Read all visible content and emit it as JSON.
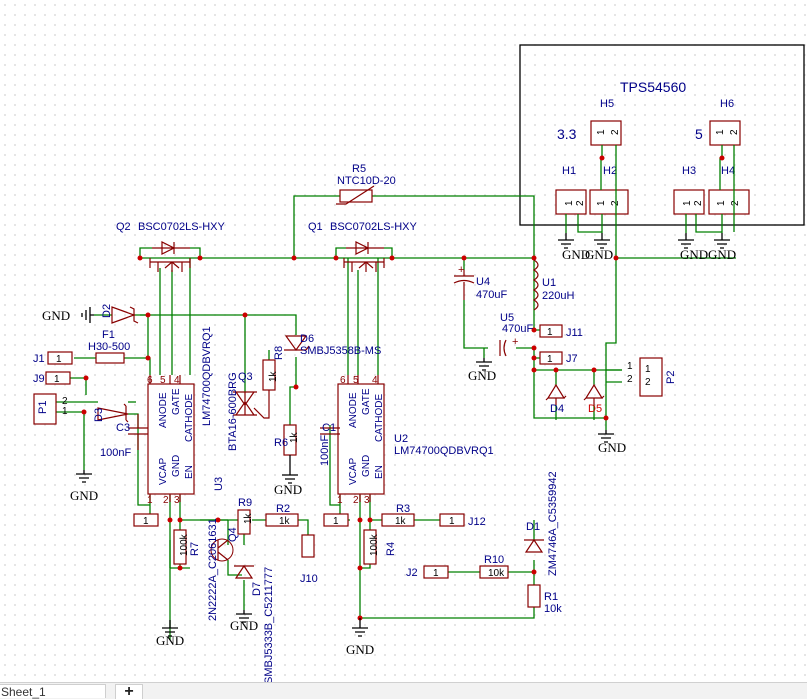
{
  "module": {
    "title": "TPS54560",
    "label_33": "3.3",
    "label_5": "5"
  },
  "headers": {
    "H1": "H1",
    "H2": "H2",
    "H3": "H3",
    "H4": "H4",
    "H5": "H5",
    "H6": "H6"
  },
  "gnd_label": "GND",
  "parts": {
    "Q1_ref": "Q1",
    "Q1_val": "BSC0702LS-HXY",
    "Q2_ref": "Q2",
    "Q2_val": "BSC0702LS-HXY",
    "R5_ref": "R5",
    "R5_val": "NTC10D-20",
    "U4_ref": "U4",
    "U4_val": "470uF",
    "U5_ref": "U5",
    "U5_val": "470uF",
    "U1_ref": "U1",
    "U1_val": "220uH",
    "F1_ref": "F1",
    "F1_val": "H30-500",
    "D2_ref": "D2",
    "D3_ref": "D3",
    "D6_ref": "D6",
    "D6_val": "SMBJ5358B-MS",
    "Q3_ref": "Q3",
    "Q3_val": "BTA16-600BRG",
    "R8_ref": "R8",
    "R6_ref": "R6",
    "U3_ref": "U3",
    "U3_val": "LM74700QDBVRQ1",
    "U2_ref": "U2",
    "U2_val": "LM74700QDBVRQ1",
    "C3_ref": "C3",
    "C3_val": "100nF",
    "C1_ref": "C1",
    "C1_val": "100nF",
    "R9_ref": "R9",
    "R2_ref": "R2",
    "R3_ref": "R3",
    "R7_ref": "R7",
    "R4_ref": "R4",
    "R10_ref": "R10",
    "R1_ref": "R1",
    "R1_val": "10k",
    "Q4_ref": "Q4",
    "Q4_val": "2N2222A_C2061631",
    "D7_ref": "D7",
    "D7_val": "SMBJ5333B_C5211777",
    "D1_ref": "D1",
    "D1_val": "ZM4746A_C5359942",
    "D4_ref": "D4",
    "D5_ref": "D5",
    "J1": "J1",
    "J2": "J2",
    "J7": "J7",
    "J9": "J9",
    "J10": "J10",
    "J11": "J11",
    "J12": "J12",
    "P1": "P1",
    "P2": "P2"
  },
  "values": {
    "r_1k": "1k",
    "r_100k": "100k",
    "r_10k": "10k"
  },
  "pins": {
    "anode": "ANODE",
    "gate": "GATE",
    "cathode": "CATHODE",
    "vcap": "VCAP",
    "gnd": "GND",
    "en": "EN",
    "n1": "1",
    "n2": "2",
    "n3": "3",
    "n4": "4",
    "n5": "5",
    "n6": "6"
  },
  "sheet": {
    "tab_label": "Sheet_1",
    "add_label": "+"
  }
}
